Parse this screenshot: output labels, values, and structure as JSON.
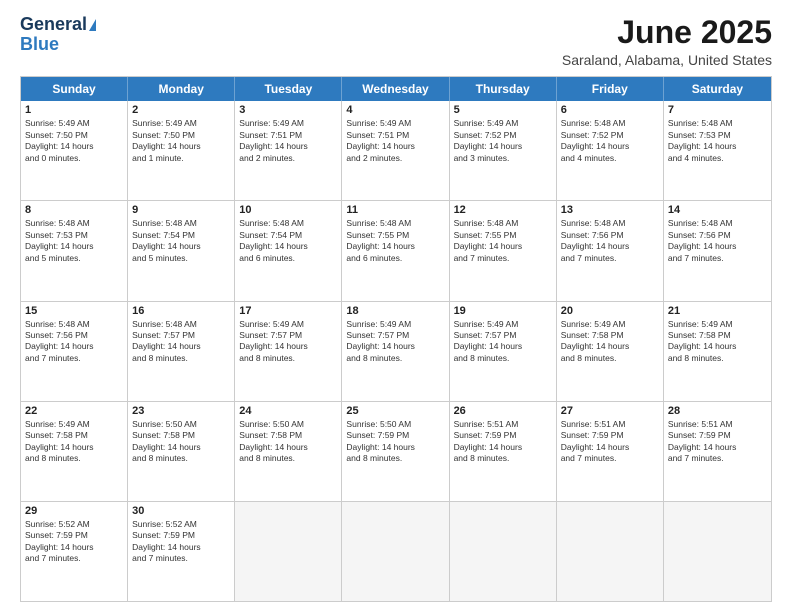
{
  "header": {
    "logo_line1": "General",
    "logo_line2": "Blue",
    "title": "June 2025",
    "subtitle": "Saraland, Alabama, United States"
  },
  "calendar": {
    "weekdays": [
      "Sunday",
      "Monday",
      "Tuesday",
      "Wednesday",
      "Thursday",
      "Friday",
      "Saturday"
    ],
    "rows": [
      [
        {
          "day": "1",
          "lines": [
            "Sunrise: 5:49 AM",
            "Sunset: 7:50 PM",
            "Daylight: 14 hours",
            "and 0 minutes."
          ]
        },
        {
          "day": "2",
          "lines": [
            "Sunrise: 5:49 AM",
            "Sunset: 7:50 PM",
            "Daylight: 14 hours",
            "and 1 minute."
          ]
        },
        {
          "day": "3",
          "lines": [
            "Sunrise: 5:49 AM",
            "Sunset: 7:51 PM",
            "Daylight: 14 hours",
            "and 2 minutes."
          ]
        },
        {
          "day": "4",
          "lines": [
            "Sunrise: 5:49 AM",
            "Sunset: 7:51 PM",
            "Daylight: 14 hours",
            "and 2 minutes."
          ]
        },
        {
          "day": "5",
          "lines": [
            "Sunrise: 5:49 AM",
            "Sunset: 7:52 PM",
            "Daylight: 14 hours",
            "and 3 minutes."
          ]
        },
        {
          "day": "6",
          "lines": [
            "Sunrise: 5:48 AM",
            "Sunset: 7:52 PM",
            "Daylight: 14 hours",
            "and 4 minutes."
          ]
        },
        {
          "day": "7",
          "lines": [
            "Sunrise: 5:48 AM",
            "Sunset: 7:53 PM",
            "Daylight: 14 hours",
            "and 4 minutes."
          ]
        }
      ],
      [
        {
          "day": "8",
          "lines": [
            "Sunrise: 5:48 AM",
            "Sunset: 7:53 PM",
            "Daylight: 14 hours",
            "and 5 minutes."
          ]
        },
        {
          "day": "9",
          "lines": [
            "Sunrise: 5:48 AM",
            "Sunset: 7:54 PM",
            "Daylight: 14 hours",
            "and 5 minutes."
          ]
        },
        {
          "day": "10",
          "lines": [
            "Sunrise: 5:48 AM",
            "Sunset: 7:54 PM",
            "Daylight: 14 hours",
            "and 6 minutes."
          ]
        },
        {
          "day": "11",
          "lines": [
            "Sunrise: 5:48 AM",
            "Sunset: 7:55 PM",
            "Daylight: 14 hours",
            "and 6 minutes."
          ]
        },
        {
          "day": "12",
          "lines": [
            "Sunrise: 5:48 AM",
            "Sunset: 7:55 PM",
            "Daylight: 14 hours",
            "and 7 minutes."
          ]
        },
        {
          "day": "13",
          "lines": [
            "Sunrise: 5:48 AM",
            "Sunset: 7:56 PM",
            "Daylight: 14 hours",
            "and 7 minutes."
          ]
        },
        {
          "day": "14",
          "lines": [
            "Sunrise: 5:48 AM",
            "Sunset: 7:56 PM",
            "Daylight: 14 hours",
            "and 7 minutes."
          ]
        }
      ],
      [
        {
          "day": "15",
          "lines": [
            "Sunrise: 5:48 AM",
            "Sunset: 7:56 PM",
            "Daylight: 14 hours",
            "and 7 minutes."
          ]
        },
        {
          "day": "16",
          "lines": [
            "Sunrise: 5:48 AM",
            "Sunset: 7:57 PM",
            "Daylight: 14 hours",
            "and 8 minutes."
          ]
        },
        {
          "day": "17",
          "lines": [
            "Sunrise: 5:49 AM",
            "Sunset: 7:57 PM",
            "Daylight: 14 hours",
            "and 8 minutes."
          ]
        },
        {
          "day": "18",
          "lines": [
            "Sunrise: 5:49 AM",
            "Sunset: 7:57 PM",
            "Daylight: 14 hours",
            "and 8 minutes."
          ]
        },
        {
          "day": "19",
          "lines": [
            "Sunrise: 5:49 AM",
            "Sunset: 7:57 PM",
            "Daylight: 14 hours",
            "and 8 minutes."
          ]
        },
        {
          "day": "20",
          "lines": [
            "Sunrise: 5:49 AM",
            "Sunset: 7:58 PM",
            "Daylight: 14 hours",
            "and 8 minutes."
          ]
        },
        {
          "day": "21",
          "lines": [
            "Sunrise: 5:49 AM",
            "Sunset: 7:58 PM",
            "Daylight: 14 hours",
            "and 8 minutes."
          ]
        }
      ],
      [
        {
          "day": "22",
          "lines": [
            "Sunrise: 5:49 AM",
            "Sunset: 7:58 PM",
            "Daylight: 14 hours",
            "and 8 minutes."
          ]
        },
        {
          "day": "23",
          "lines": [
            "Sunrise: 5:50 AM",
            "Sunset: 7:58 PM",
            "Daylight: 14 hours",
            "and 8 minutes."
          ]
        },
        {
          "day": "24",
          "lines": [
            "Sunrise: 5:50 AM",
            "Sunset: 7:58 PM",
            "Daylight: 14 hours",
            "and 8 minutes."
          ]
        },
        {
          "day": "25",
          "lines": [
            "Sunrise: 5:50 AM",
            "Sunset: 7:59 PM",
            "Daylight: 14 hours",
            "and 8 minutes."
          ]
        },
        {
          "day": "26",
          "lines": [
            "Sunrise: 5:51 AM",
            "Sunset: 7:59 PM",
            "Daylight: 14 hours",
            "and 8 minutes."
          ]
        },
        {
          "day": "27",
          "lines": [
            "Sunrise: 5:51 AM",
            "Sunset: 7:59 PM",
            "Daylight: 14 hours",
            "and 7 minutes."
          ]
        },
        {
          "day": "28",
          "lines": [
            "Sunrise: 5:51 AM",
            "Sunset: 7:59 PM",
            "Daylight: 14 hours",
            "and 7 minutes."
          ]
        }
      ],
      [
        {
          "day": "29",
          "lines": [
            "Sunrise: 5:52 AM",
            "Sunset: 7:59 PM",
            "Daylight: 14 hours",
            "and 7 minutes."
          ]
        },
        {
          "day": "30",
          "lines": [
            "Sunrise: 5:52 AM",
            "Sunset: 7:59 PM",
            "Daylight: 14 hours",
            "and 7 minutes."
          ]
        },
        {
          "day": "",
          "lines": [],
          "empty": true
        },
        {
          "day": "",
          "lines": [],
          "empty": true
        },
        {
          "day": "",
          "lines": [],
          "empty": true
        },
        {
          "day": "",
          "lines": [],
          "empty": true
        },
        {
          "day": "",
          "lines": [],
          "empty": true
        }
      ]
    ]
  }
}
